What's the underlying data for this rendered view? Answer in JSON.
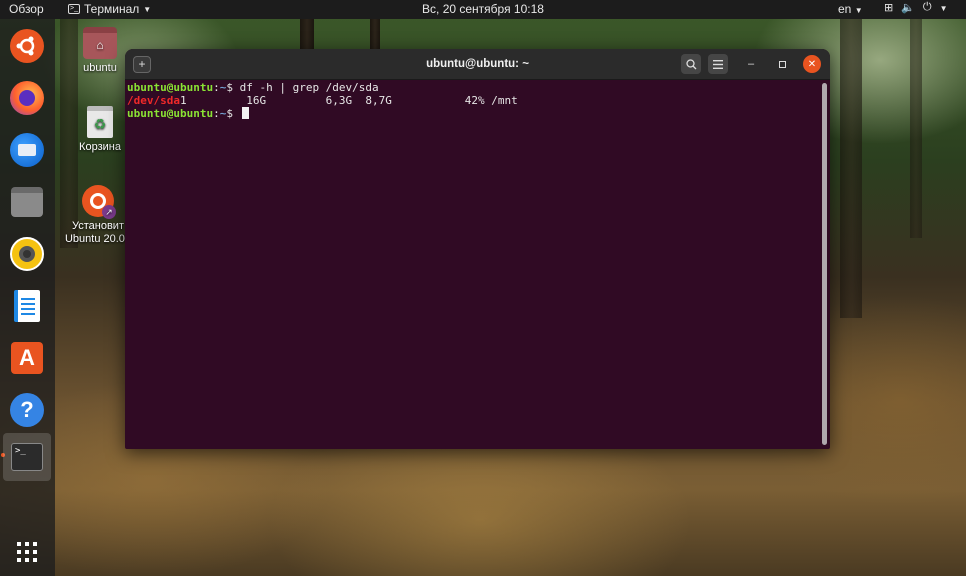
{
  "topbar": {
    "activities": "Обзор",
    "app_menu": "Терминал",
    "clock": "Вс, 20 сентября  10:18",
    "language": "en"
  },
  "dock": {
    "items": [
      {
        "name": "ubuntu-installer",
        "color": "#e95420"
      },
      {
        "name": "firefox",
        "color": "#ff7139"
      },
      {
        "name": "thunderbird",
        "color": "#0a84ff"
      },
      {
        "name": "files",
        "color": "#7a7a7a"
      },
      {
        "name": "rhythmbox",
        "color": "#f5c211"
      },
      {
        "name": "libreoffice-writer",
        "color": "#1e88e5"
      },
      {
        "name": "ubuntu-software",
        "color": "#e95420"
      },
      {
        "name": "help",
        "color": "#3584e4"
      },
      {
        "name": "terminal",
        "color": "#2b2b2b"
      }
    ],
    "show_apps": "show-applications"
  },
  "desktop": {
    "home_label": "ubuntu",
    "trash_label": "Корзина",
    "installer_label_line1": "Установит",
    "installer_label_line2": "Ubuntu 20.04"
  },
  "terminal": {
    "title": "ubuntu@ubuntu: ~",
    "prompt_user": "ubuntu@ubuntu",
    "prompt_sep": ":",
    "prompt_path": "~",
    "prompt_dollar": "$ ",
    "command": "df -h | grep /dev/sda",
    "output_device": "/dev/sda",
    "output_rest": "1         16G         6,3G  8,7G           42% /mnt"
  }
}
